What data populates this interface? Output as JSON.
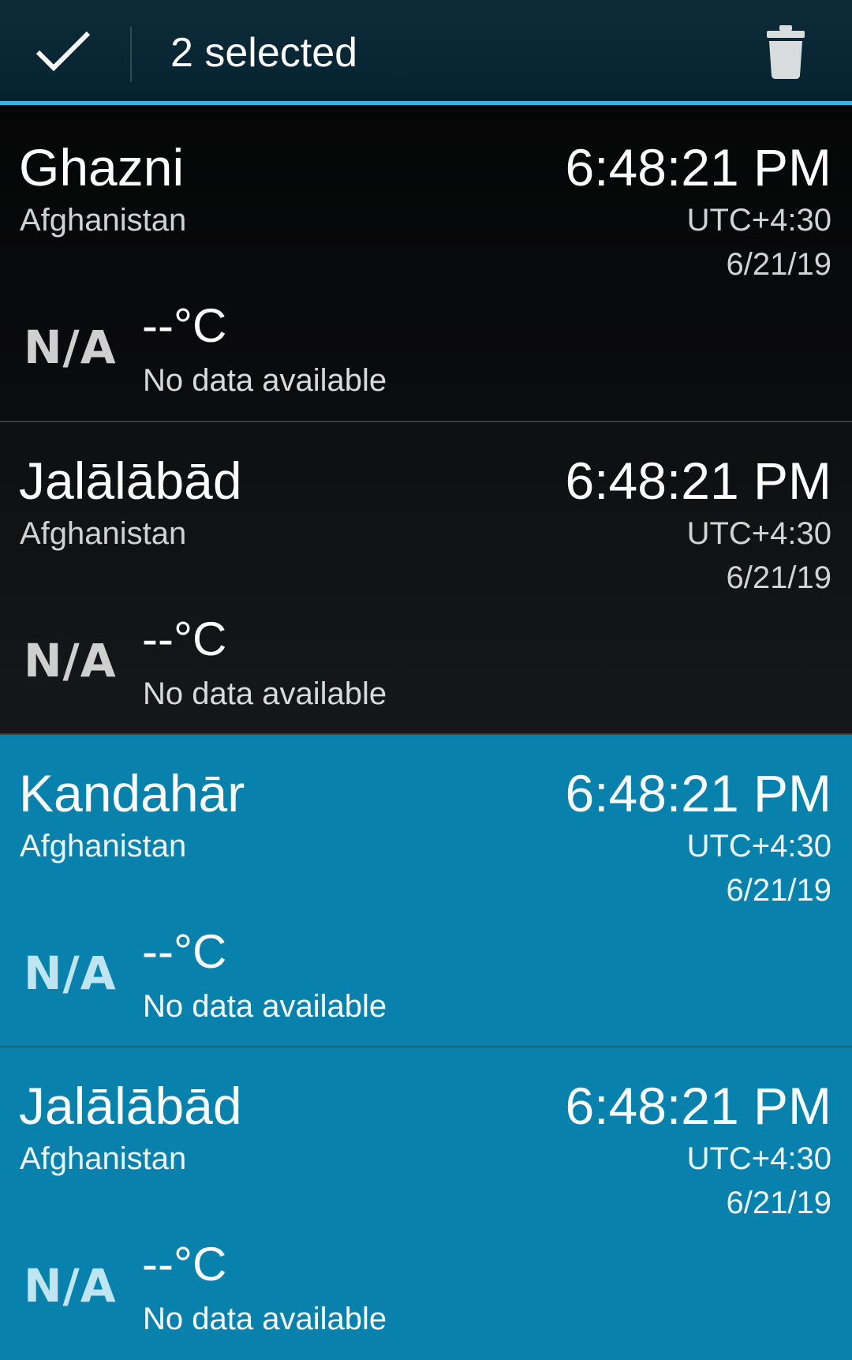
{
  "action_bar": {
    "done_icon": "checkmark-icon",
    "selected_label": "2 selected",
    "delete_icon": "trash-icon",
    "accent_color": "#33b5e5",
    "background_color": "#052230"
  },
  "selection_color": "#0981ad",
  "cities": [
    {
      "name": "Ghazni",
      "country": "Afghanistan",
      "time": "6:48:21 PM",
      "utc_offset": "UTC+4:30",
      "date": "6/21/19",
      "weather_icon": "N/A",
      "temperature": "--°C",
      "condition": "No data available",
      "selected": false
    },
    {
      "name": "Jalālābād",
      "country": "Afghanistan",
      "time": "6:48:21 PM",
      "utc_offset": "UTC+4:30",
      "date": "6/21/19",
      "weather_icon": "N/A",
      "temperature": "--°C",
      "condition": "No data available",
      "selected": false
    },
    {
      "name": "Kandahār",
      "country": "Afghanistan",
      "time": "6:48:21 PM",
      "utc_offset": "UTC+4:30",
      "date": "6/21/19",
      "weather_icon": "N/A",
      "temperature": "--°C",
      "condition": "No data available",
      "selected": true
    },
    {
      "name": "Jalālābād",
      "country": "Afghanistan",
      "time": "6:48:21 PM",
      "utc_offset": "UTC+4:30",
      "date": "6/21/19",
      "weather_icon": "N/A",
      "temperature": "--°C",
      "condition": "No data available",
      "selected": true
    }
  ]
}
